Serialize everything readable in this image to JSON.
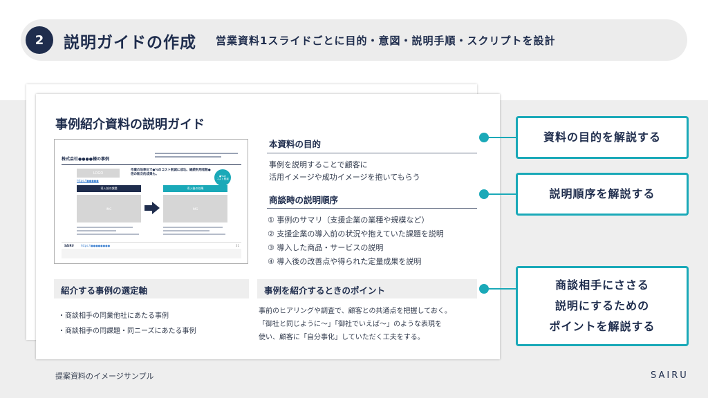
{
  "header": {
    "step_number": "2",
    "title": "説明ガイドの作成",
    "subtitle": "営業資料1スライドごとに目的・意図・説明手順・スクリプトを設計"
  },
  "guide": {
    "title": "事例紹介資料の説明ガイド",
    "thumbnail": {
      "title": "株式会社●●●●様の事例",
      "logo_label": "LOGO",
      "link_text": "https://●●●●●",
      "headline": "作業の効率化で●%のコスト削減に成功。継続利用者数●倍の新次的成果も。",
      "badge": "●%の\nコスト削減",
      "before_label": "導入前の課題",
      "after_label": "導入後の効果",
      "image_placeholder": "IMG",
      "brand": "SAIRU",
      "footer_link": "https://●●●●●●●●",
      "page_number": "31"
    },
    "purpose": {
      "heading": "本資料の目的",
      "lines": [
        "事例を説明することで顧客に",
        "活用イメージや成功イメージを抱いてもらう"
      ]
    },
    "procedure": {
      "heading": "商談時の説明順序",
      "steps": [
        "① 事例のサマリ（支援企業の業種や規模など）",
        "② 支援企業の導入前の状況や抱えていた課題を説明",
        "③ 導入した商品・サービスの説明",
        "④ 導入後の改善点や得られた定量成果を説明"
      ]
    },
    "selection": {
      "heading": "紹介する事例の選定軸",
      "items": [
        "・商談相手の同業他社にあたる事例",
        "・商談相手の同課題・同ニーズにあたる事例"
      ]
    },
    "points": {
      "heading": "事例を紹介するときのポイント",
      "lines": [
        "事前のヒアリングや調査で、顧客との共通点を把握しておく。",
        "「御社と同じように～」「御社でいえば～」のような表現を",
        "使い、顧客に「自分事化」していただく工夫をする。"
      ]
    }
  },
  "callouts": [
    {
      "text": "資料の目的を解説する"
    },
    {
      "text": "説明順序を解説する"
    },
    {
      "text": "商談相手にささる\n説明にするための\nポイントを解説する"
    }
  ],
  "footer": {
    "caption": "提案資料のイメージサンプル",
    "brand": "SAIRU"
  },
  "colors": {
    "navy": "#1f2d4d",
    "teal": "#1aa9b8",
    "panel_gray": "#eeeeee"
  }
}
